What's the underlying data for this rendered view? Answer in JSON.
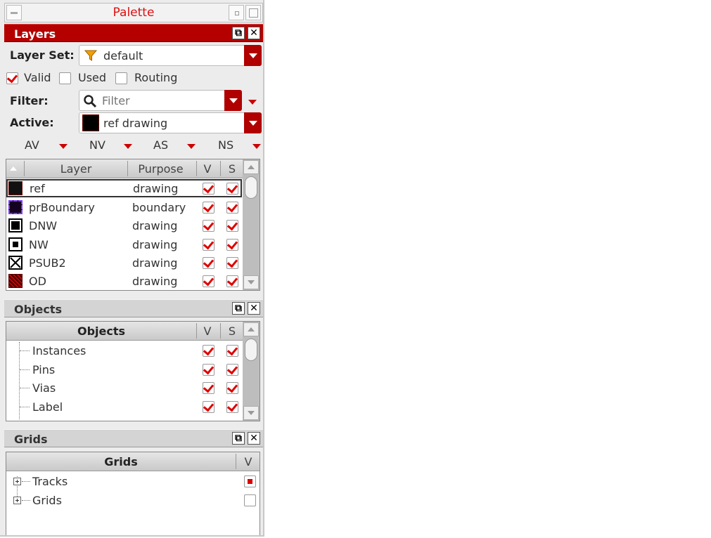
{
  "window": {
    "title": "Palette"
  },
  "layers": {
    "header": "Layers",
    "layer_set_label": "Layer Set:",
    "layer_set_value": "default",
    "checks": [
      {
        "label": "Valid",
        "checked": true
      },
      {
        "label": "Used",
        "checked": false
      },
      {
        "label": "Routing",
        "checked": false
      }
    ],
    "filter_label": "Filter:",
    "filter_placeholder": "Filter",
    "active_label": "Active:",
    "active_value": "ref drawing",
    "visibility_buttons": [
      "AV",
      "NV",
      "AS",
      "NS"
    ],
    "columns": {
      "layer": "Layer",
      "purpose": "Purpose",
      "v": "V",
      "s": "S"
    },
    "rows": [
      {
        "layer": "ref",
        "purpose": "drawing",
        "v": true,
        "s": true,
        "selected": true
      },
      {
        "layer": "prBoundary",
        "purpose": "boundary",
        "v": true,
        "s": true
      },
      {
        "layer": "DNW",
        "purpose": "drawing",
        "v": true,
        "s": true
      },
      {
        "layer": "NW",
        "purpose": "drawing",
        "v": true,
        "s": true
      },
      {
        "layer": "PSUB2",
        "purpose": "drawing",
        "v": true,
        "s": true
      },
      {
        "layer": "OD",
        "purpose": "drawing",
        "v": true,
        "s": true
      }
    ]
  },
  "objects": {
    "header": "Objects",
    "columns": {
      "name": "Objects",
      "v": "V",
      "s": "S"
    },
    "rows": [
      {
        "name": "Instances",
        "v": true,
        "s": true
      },
      {
        "name": "Pins",
        "v": true,
        "s": true
      },
      {
        "name": "Vias",
        "v": true,
        "s": true
      },
      {
        "name": "Label",
        "v": true,
        "s": true
      }
    ]
  },
  "grids": {
    "header": "Grids",
    "columns": {
      "name": "Grids",
      "v": "V"
    },
    "rows": [
      {
        "name": "Tracks",
        "state": "partial"
      },
      {
        "name": "Grids",
        "state": "unchecked"
      }
    ]
  },
  "colors": {
    "accent": "#b50000",
    "check": "#d00000"
  }
}
